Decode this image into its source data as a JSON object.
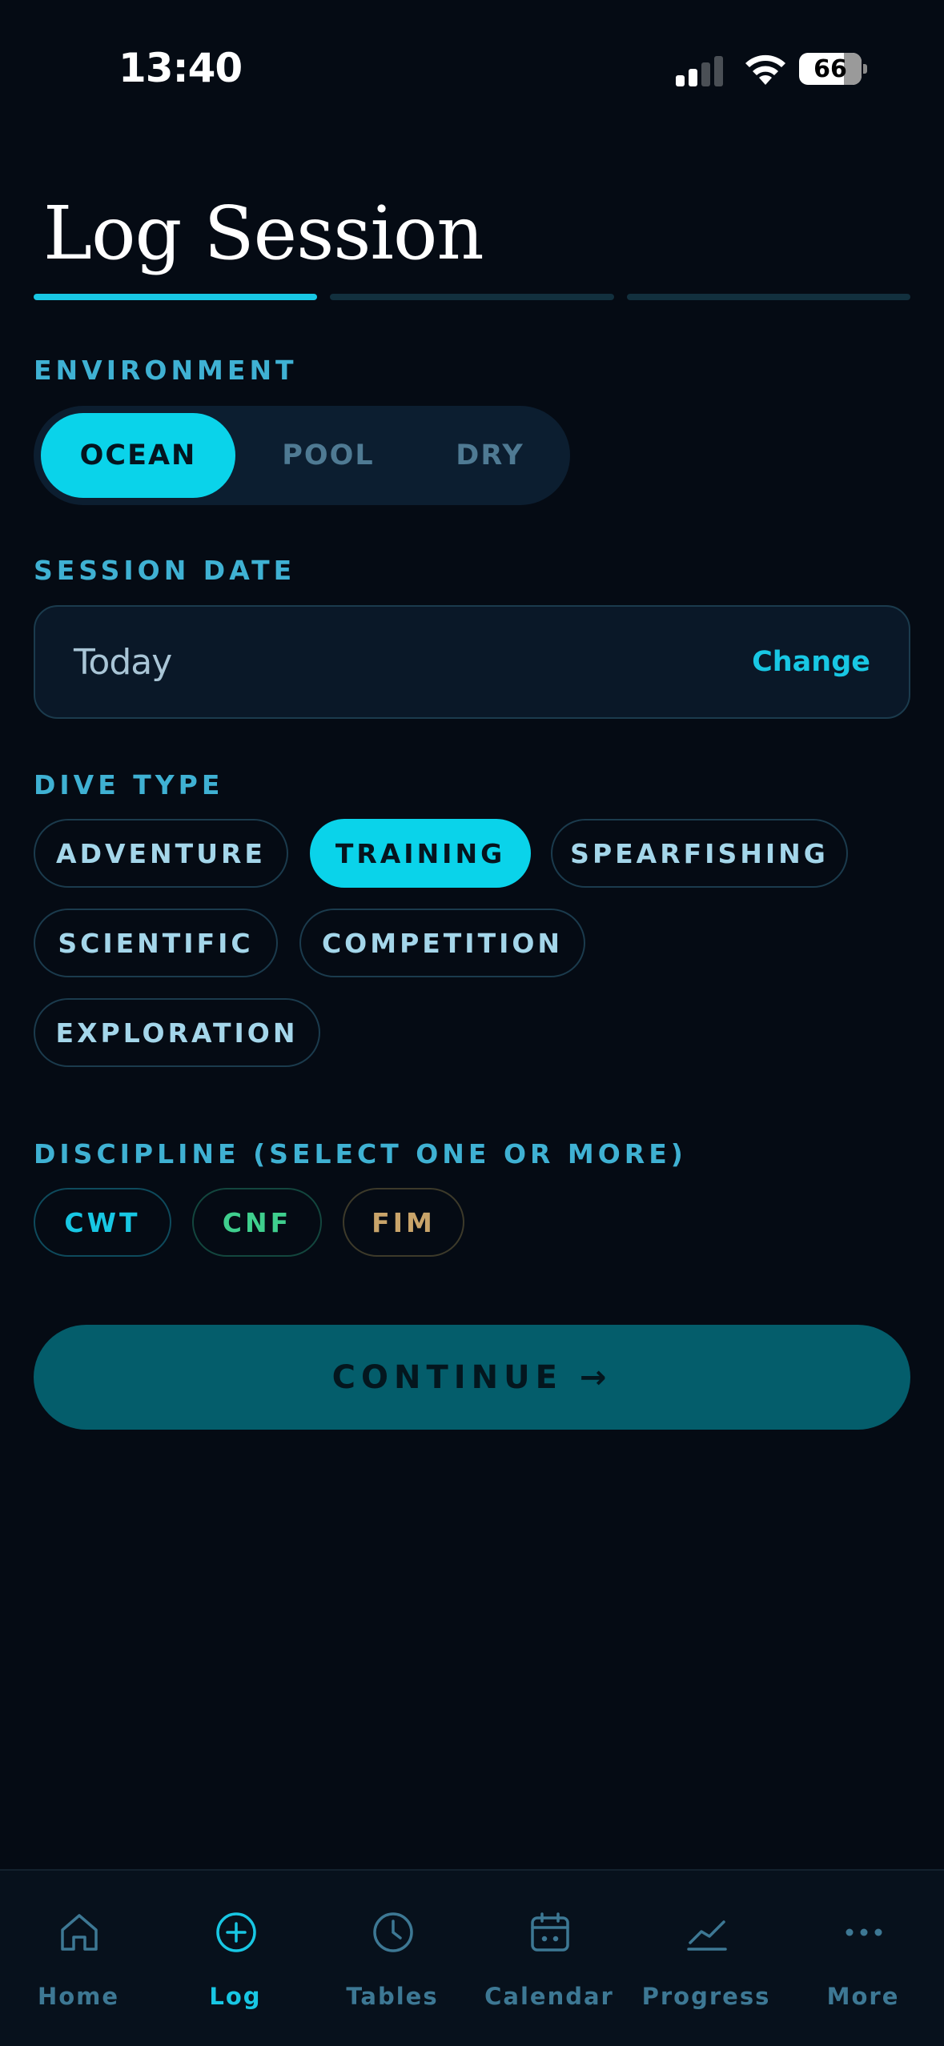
{
  "status_bar": {
    "time": "13:40",
    "battery": "66"
  },
  "title": "Log Session",
  "environment": {
    "label": "ENVIRONMENT",
    "options": [
      "OCEAN",
      "POOL",
      "DRY"
    ],
    "selected": "OCEAN"
  },
  "session_date": {
    "label": "SESSION DATE",
    "value": "Today",
    "change_label": "Change"
  },
  "dive_type": {
    "label": "DIVE TYPE",
    "options": [
      "ADVENTURE",
      "TRAINING",
      "SPEARFISHING",
      "SCIENTIFIC",
      "COMPETITION",
      "EXPLORATION"
    ],
    "selected": "TRAINING"
  },
  "discipline": {
    "label": "DISCIPLINE (SELECT ONE OR MORE)",
    "options": [
      "CWT",
      "CNF",
      "FIM"
    ]
  },
  "continue_label": "CONTINUE →",
  "tabs": [
    "Home",
    "Log",
    "Tables",
    "Calendar",
    "Progress",
    "More"
  ],
  "active_tab": "Log",
  "colors": {
    "accent": "#0ad3ea",
    "cwt": "#18c7e4",
    "cnf": "#3fcf8e",
    "fim": "#c9a46a"
  }
}
